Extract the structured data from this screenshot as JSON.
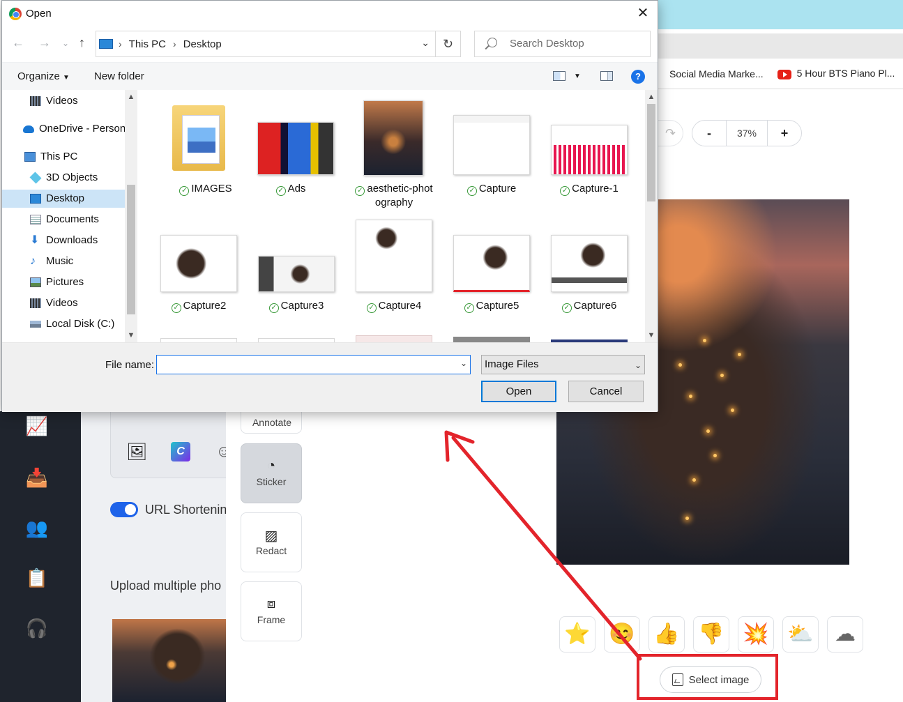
{
  "browser": {
    "bookmarks": [
      {
        "label": "Social Media Marke..."
      },
      {
        "label": "5 Hour BTS Piano Pl..."
      }
    ]
  },
  "editor": {
    "zoom_minus": "-",
    "zoom_value": "37%",
    "zoom_plus": "+",
    "tools": [
      {
        "label": "Annotate"
      },
      {
        "label": "Sticker"
      },
      {
        "label": "Redact"
      },
      {
        "label": "Frame"
      }
    ],
    "stickers": [
      "⭐",
      "😊",
      "👍",
      "👎",
      "💥",
      "⛅",
      "☁"
    ],
    "select_image_label": "Select image",
    "url_shortening_label": "URL Shortenin",
    "upload_label": "Upload multiple pho"
  },
  "dialog": {
    "title": "Open",
    "close": "✕",
    "breadcrumb": [
      "This PC",
      "Desktop"
    ],
    "search_placeholder": "Search Desktop",
    "toolbar": {
      "organize": "Organize",
      "new_folder": "New folder",
      "help": "?"
    },
    "nav_items": [
      {
        "label": "Videos"
      },
      {
        "label": "OneDrive - Person"
      },
      {
        "label": "This PC"
      },
      {
        "label": "3D Objects"
      },
      {
        "label": "Desktop"
      },
      {
        "label": "Documents"
      },
      {
        "label": "Downloads"
      },
      {
        "label": "Music"
      },
      {
        "label": "Pictures"
      },
      {
        "label": "Videos"
      },
      {
        "label": "Local Disk (C:)"
      }
    ],
    "files": [
      {
        "name": "IMAGES",
        "kind": "folder"
      },
      {
        "name": "Ads",
        "kind": "photo-city"
      },
      {
        "name": "aesthetic-phot ography",
        "kind": "photo-jar"
      },
      {
        "name": "Capture",
        "kind": "screenshot"
      },
      {
        "name": "Capture-1",
        "kind": "chart"
      },
      {
        "name": "Capture2",
        "kind": "screenshot"
      },
      {
        "name": "Capture3",
        "kind": "screenshot"
      },
      {
        "name": "Capture4",
        "kind": "screenshot"
      },
      {
        "name": "Capture5",
        "kind": "screenshot"
      },
      {
        "name": "Capture6",
        "kind": "screenshot"
      }
    ],
    "file_name_label": "File name:",
    "file_name_value": "",
    "file_type": "Image Files",
    "open_button": "Open",
    "cancel_button": "Cancel"
  },
  "colors": {
    "accent": "#1a73e8",
    "selection": "#cce4f7",
    "annotation_red": "#e3242b",
    "sidebar_dark": "#1f242d"
  }
}
